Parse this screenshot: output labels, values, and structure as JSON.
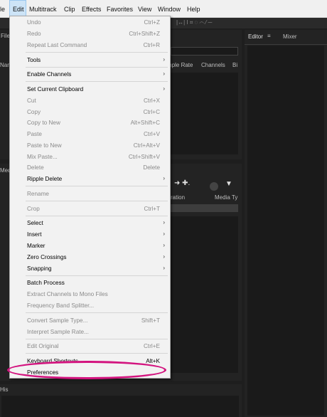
{
  "menubar": [
    {
      "label": "le",
      "active": false
    },
    {
      "label": "Edit",
      "active": true
    },
    {
      "label": "Multitrack",
      "active": false
    },
    {
      "label": "Clip",
      "active": false
    },
    {
      "label": "Effects",
      "active": false
    },
    {
      "label": "Favorites",
      "active": false
    },
    {
      "label": "View",
      "active": false
    },
    {
      "label": "Window",
      "active": false
    },
    {
      "label": "Help",
      "active": false
    }
  ],
  "background": {
    "files_tab": "File",
    "editor_tab": "Editor",
    "mixer_tab": "Mixer",
    "col_sample_rate": "mple Rate",
    "col_channels": "Channels",
    "col_bits": "Bi",
    "col_duration": "ration",
    "col_media_type": "Media Ty",
    "media_tab": "Med",
    "history_tab": "His",
    "left_label": "Nam"
  },
  "edit_menu": {
    "items": [
      {
        "label": "Undo",
        "shortcut": "Ctrl+Z",
        "enabled": false,
        "submenu": false
      },
      {
        "label": "Redo",
        "shortcut": "Ctrl+Shift+Z",
        "enabled": false,
        "submenu": false
      },
      {
        "label": "Repeat Last Command",
        "shortcut": "Ctrl+R",
        "enabled": false,
        "submenu": false
      },
      {
        "label": "Tools",
        "shortcut": "",
        "enabled": true,
        "submenu": true
      },
      {
        "label": "Enable Channels",
        "shortcut": "",
        "enabled": true,
        "submenu": true
      },
      {
        "label": "Set Current Clipboard",
        "shortcut": "",
        "enabled": true,
        "submenu": true
      },
      {
        "label": "Cut",
        "shortcut": "Ctrl+X",
        "enabled": false,
        "submenu": false
      },
      {
        "label": "Copy",
        "shortcut": "Ctrl+C",
        "enabled": false,
        "submenu": false
      },
      {
        "label": "Copy to New",
        "shortcut": "Alt+Shift+C",
        "enabled": false,
        "submenu": false
      },
      {
        "label": "Paste",
        "shortcut": "Ctrl+V",
        "enabled": false,
        "submenu": false
      },
      {
        "label": "Paste to New",
        "shortcut": "Ctrl+Alt+V",
        "enabled": false,
        "submenu": false
      },
      {
        "label": "Mix Paste...",
        "shortcut": "Ctrl+Shift+V",
        "enabled": false,
        "submenu": false
      },
      {
        "label": "Delete",
        "shortcut": "Delete",
        "enabled": false,
        "submenu": false
      },
      {
        "label": "Ripple Delete",
        "shortcut": "",
        "enabled": true,
        "submenu": true
      },
      {
        "label": "Rename",
        "shortcut": "",
        "enabled": false,
        "submenu": false
      },
      {
        "label": "Crop",
        "shortcut": "Ctrl+T",
        "enabled": false,
        "submenu": false
      },
      {
        "label": "Select",
        "shortcut": "",
        "enabled": true,
        "submenu": true
      },
      {
        "label": "Insert",
        "shortcut": "",
        "enabled": true,
        "submenu": true
      },
      {
        "label": "Marker",
        "shortcut": "",
        "enabled": true,
        "submenu": true
      },
      {
        "label": "Zero Crossings",
        "shortcut": "",
        "enabled": true,
        "submenu": true
      },
      {
        "label": "Snapping",
        "shortcut": "",
        "enabled": true,
        "submenu": true
      },
      {
        "label": "Batch Process",
        "shortcut": "",
        "enabled": true,
        "submenu": false
      },
      {
        "label": "Extract Channels to Mono Files",
        "shortcut": "",
        "enabled": false,
        "submenu": false
      },
      {
        "label": "Frequency Band Splitter...",
        "shortcut": "",
        "enabled": false,
        "submenu": false
      },
      {
        "label": "Convert Sample Type...",
        "shortcut": "Shift+T",
        "enabled": false,
        "submenu": false
      },
      {
        "label": "Interpret Sample Rate...",
        "shortcut": "",
        "enabled": false,
        "submenu": false
      },
      {
        "label": "Edit Original",
        "shortcut": "Ctrl+E",
        "enabled": false,
        "submenu": false
      },
      {
        "label": "Keyboard Shortcuts",
        "shortcut": "Alt+K",
        "enabled": true,
        "submenu": false
      },
      {
        "label": "Preferences",
        "shortcut": "",
        "enabled": true,
        "submenu": true
      }
    ],
    "submenu_arrow": "›"
  },
  "colors": {
    "highlight_ring": "#d3147f",
    "menu_bg": "#f2f2f2",
    "app_bg": "#232323"
  }
}
